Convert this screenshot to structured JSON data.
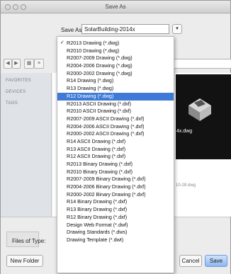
{
  "window": {
    "title": "Save As"
  },
  "save_as": {
    "label": "Save As:",
    "value": "SolarBuilding-2014x"
  },
  "sidebar": {
    "favorites": "FAVORITES",
    "devices": "DEVICES",
    "tags": "TAGS"
  },
  "search": {
    "placeholder": "Q"
  },
  "preview": {
    "caption": "4x.dwg"
  },
  "file_meta": {
    "text": "10-28.dwg"
  },
  "footer": {
    "files_of_type_label": "Files of Type:",
    "new_folder": "New Folder",
    "cancel": "Cancel",
    "save": "Save"
  },
  "dropdown": {
    "checked_index": 0,
    "selected_index": 7,
    "options": [
      "R2013 Drawing (*.dwg)",
      "R2010 Drawing (*.dwg)",
      "R2007-2009 Drawing (*.dwg)",
      "R2004-2006 Drawing (*.dwg)",
      "R2000-2002 Drawing (*.dwg)",
      "R14 Drawing (*.dwg)",
      "R13 Drawing (*.dwg)",
      "R12 Drawing (*.dwg)",
      "R2013 ASCII Drawing (*.dxf)",
      "R2010 ASCII Drawing (*.dxf)",
      "R2007-2009 ASCII Drawing (*.dxf)",
      "R2004-2006 ASCII Drawing (*.dxf)",
      "R2000-2002 ASCII Drawing (*.dxf)",
      "R14 ASCII Drawing (*.dxf)",
      "R13 ASCII Drawing (*.dxf)",
      "R12 ASCII Drawing (*.dxf)",
      "R2013 Binary Drawing (*.dxf)",
      "R2010 Binary Drawing (*.dxf)",
      "R2007-2009 Binary Drawing (*.dxf)",
      "R2004-2006 Binary Drawing (*.dxf)",
      "R2000-2002 Binary Drawing (*.dxf)",
      "R14 Binary Drawing (*.dxf)",
      "R13 Binary Drawing (*.dxf)",
      "R12 Binary Drawing (*.dxf)",
      "Design Web Format (*.dwf)",
      "Drawing Standards (*.dws)",
      "Drawing Template (*.dwt)"
    ]
  },
  "colors": {
    "selection": "#3f7bd6",
    "save_button": "#8db7ef"
  }
}
